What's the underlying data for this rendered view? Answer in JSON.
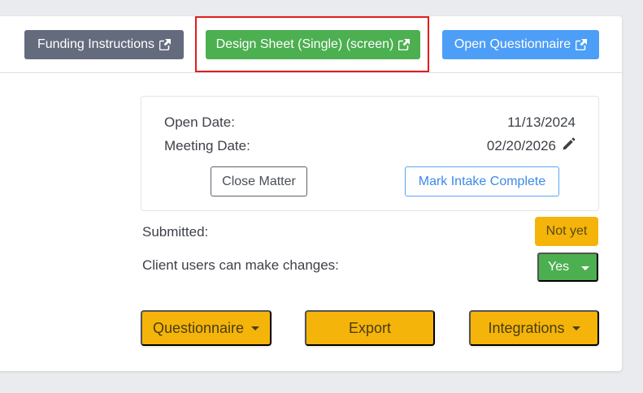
{
  "header": {
    "funding_label": "Funding Instructions",
    "design_sheet_label": "Design Sheet (Single) (screen)",
    "questionnaire_label": "Open Questionnaire"
  },
  "info": {
    "open_date_label": "Open Date:",
    "open_date_value": "11/13/2024",
    "meeting_date_label": "Meeting Date:",
    "meeting_date_value": "02/20/2026",
    "close_matter_label": "Close Matter",
    "mark_intake_label": "Mark Intake Complete"
  },
  "status": {
    "submitted_label": "Submitted:",
    "submitted_value": "Not yet",
    "client_changes_label": "Client users can make changes:",
    "client_changes_value": "Yes"
  },
  "actions": {
    "questionnaire_label": "Questionnaire",
    "export_label": "Export",
    "integrations_label": "Integrations"
  },
  "colors": {
    "gray_button": "#646b7d",
    "green_button": "#4caf50",
    "blue_button": "#4d9ef7",
    "yellow_button": "#f4b40a",
    "highlight": "#e01e1e"
  },
  "icons": {
    "external_link": "external-link-icon",
    "edit": "pencil-icon",
    "dropdown": "caret-down-icon"
  }
}
